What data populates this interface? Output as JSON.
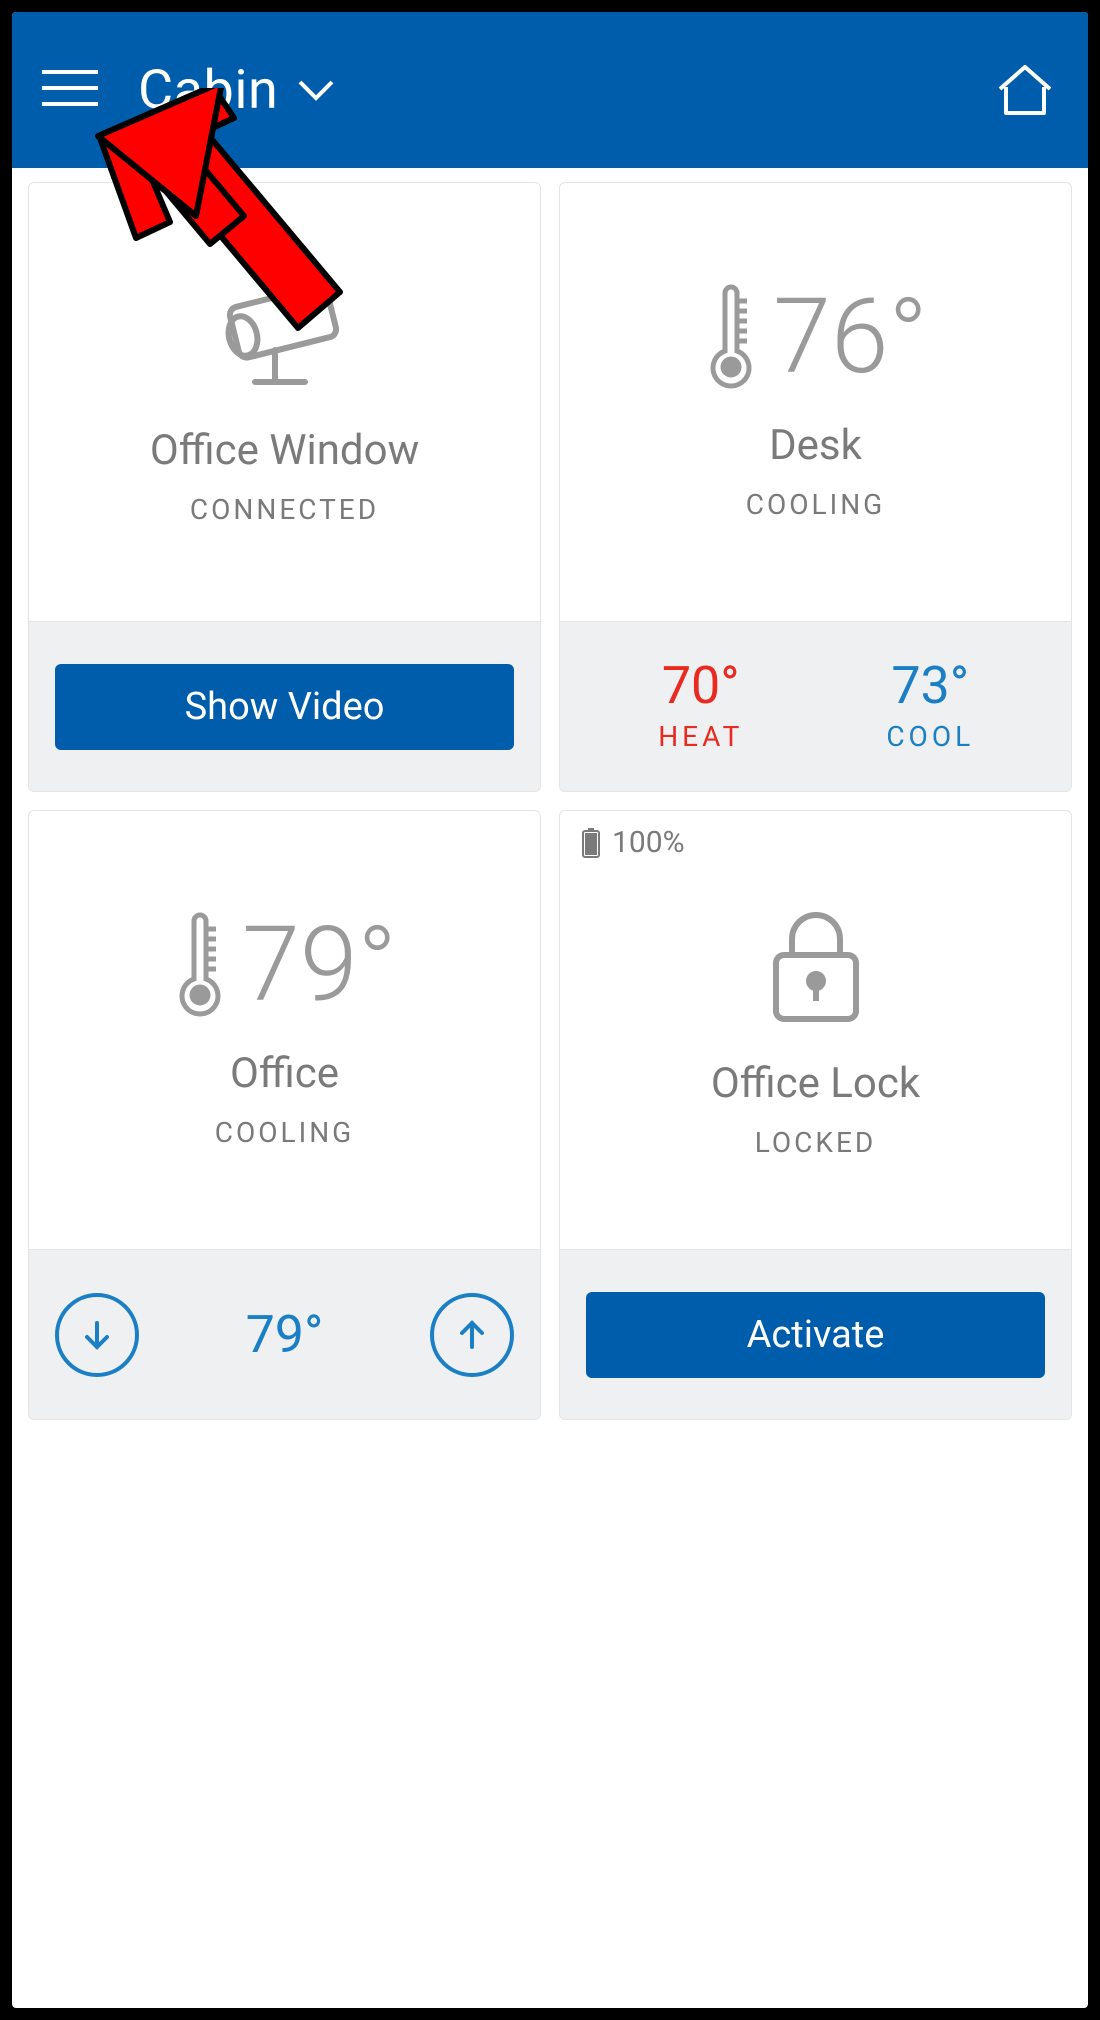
{
  "header": {
    "location": "Cabin"
  },
  "tiles": {
    "camera": {
      "name": "Office Window",
      "status": "CONNECTED",
      "action": "Show Video"
    },
    "desk": {
      "temp": "76°",
      "name": "Desk",
      "status": "COOLING",
      "heat_val": "70°",
      "heat_lbl": "HEAT",
      "cool_val": "73°",
      "cool_lbl": "COOL"
    },
    "office": {
      "temp": "79°",
      "name": "Office",
      "status": "COOLING",
      "setpoint": "79°"
    },
    "lock": {
      "battery": "100%",
      "name": "Office Lock",
      "status": "LOCKED",
      "action": "Activate"
    }
  }
}
